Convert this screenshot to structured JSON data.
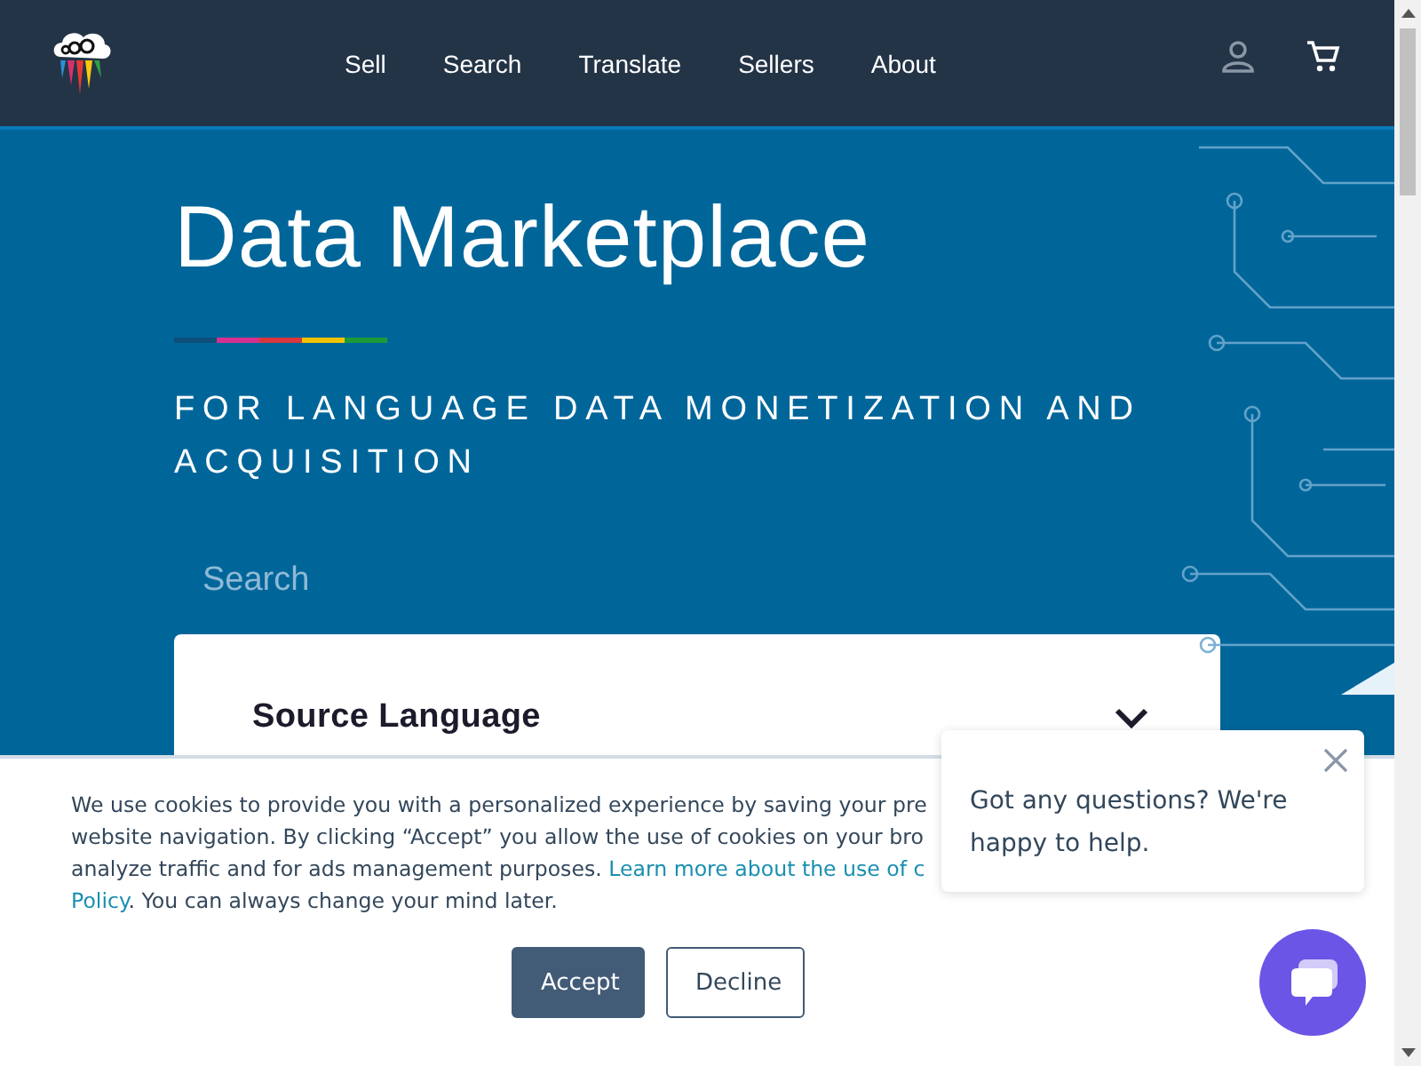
{
  "header": {
    "nav": [
      {
        "label": "Sell"
      },
      {
        "label": "Search"
      },
      {
        "label": "Translate"
      },
      {
        "label": "Sellers"
      },
      {
        "label": "About"
      }
    ]
  },
  "hero": {
    "title": "Data Marketplace",
    "subtitle": "FOR LANGUAGE DATA MONETIZATION AND ACQUISITION",
    "search": {
      "placeholder": "Search"
    },
    "filter": {
      "label": "Source Language"
    }
  },
  "cookie_banner": {
    "lines": [
      [
        {
          "kind": "plain",
          "text": "We use cookies to provide you with a personalized experience by saving your pre"
        }
      ],
      [
        {
          "kind": "plain",
          "text": "website navigation. By clicking “Accept” you allow the use of cookies on your bro"
        }
      ],
      [
        {
          "kind": "plain",
          "text": "analyze traffic and for ads management purposes. "
        },
        {
          "kind": "link",
          "text": "Learn more about the use of c"
        }
      ],
      [
        {
          "kind": "link",
          "text": "Policy"
        },
        {
          "kind": "plain",
          "text": ". You can always change your mind later."
        }
      ]
    ],
    "buttons": [
      {
        "label": "Accept",
        "kind": "primary"
      },
      {
        "label": "Decline",
        "kind": "secondary"
      }
    ]
  },
  "chat": {
    "message": "Got any questions? We're happy to help."
  }
}
